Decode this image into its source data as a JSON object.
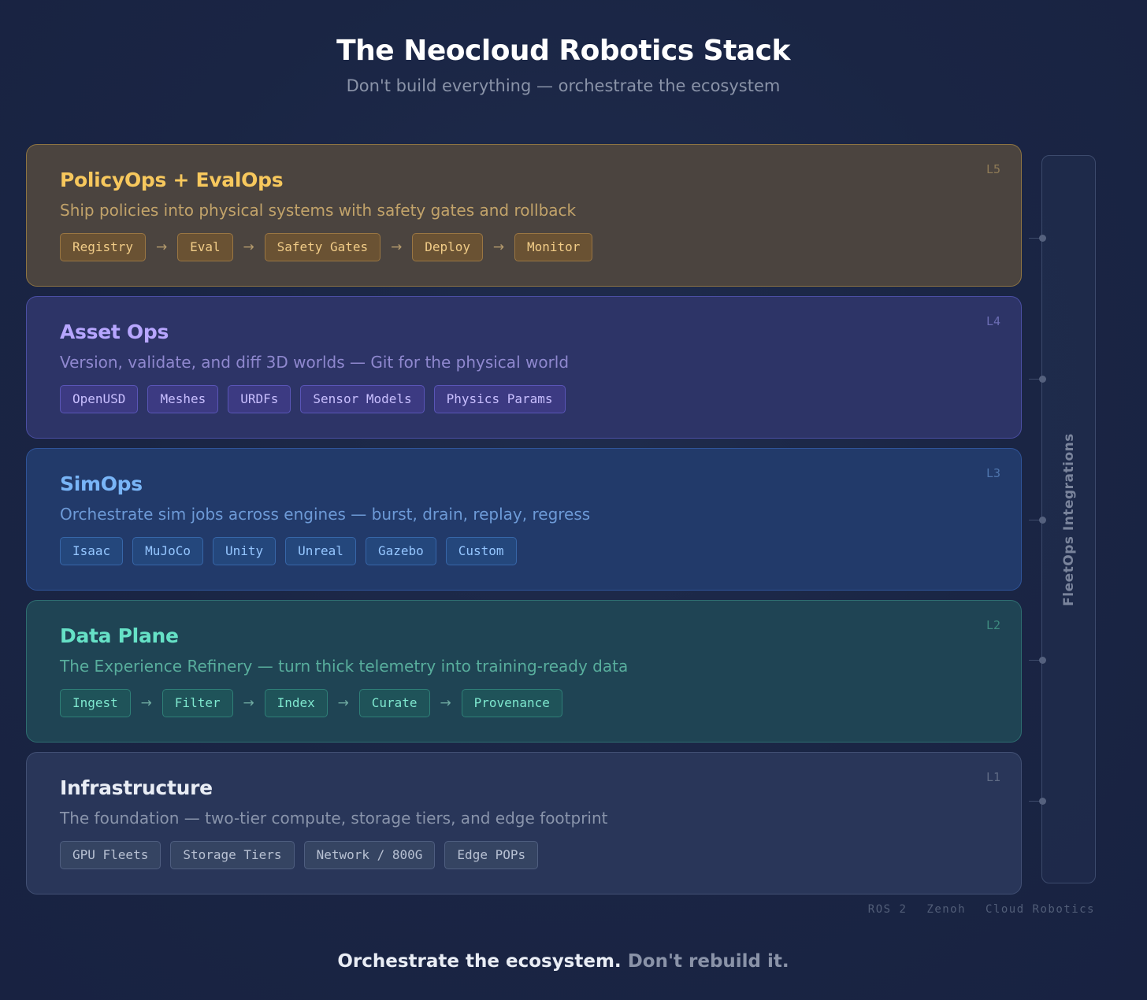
{
  "header": {
    "title": "The Neocloud Robotics Stack",
    "subtitle": "Don't build everything — orchestrate the ecosystem"
  },
  "layers": {
    "l5": {
      "num": "L5",
      "title": "PolicyOps + EvalOps",
      "desc": "Ship policies into physical systems with safety gates and rollback",
      "chips": [
        "Registry",
        "Eval",
        "Safety Gates",
        "Deploy",
        "Monitor"
      ],
      "arrow": "→"
    },
    "l4": {
      "num": "L4",
      "title": "Asset Ops",
      "desc": "Version, validate, and diff 3D worlds — Git for the physical world",
      "chips": [
        "OpenUSD",
        "Meshes",
        "URDFs",
        "Sensor Models",
        "Physics Params"
      ]
    },
    "l3": {
      "num": "L3",
      "title": "SimOps",
      "desc": "Orchestrate sim jobs across engines — burst, drain, replay, regress",
      "chips": [
        "Isaac",
        "MuJoCo",
        "Unity",
        "Unreal",
        "Gazebo",
        "Custom"
      ]
    },
    "l2": {
      "num": "L2",
      "title": "Data Plane",
      "desc": "The Experience Refinery — turn thick telemetry into training-ready data",
      "chips": [
        "Ingest",
        "Filter",
        "Index",
        "Curate",
        "Provenance"
      ],
      "arrow": "→"
    },
    "l1": {
      "num": "L1",
      "title": "Infrastructure",
      "desc": "The foundation — two-tier compute, storage tiers, and edge footprint",
      "chips": [
        "GPU Fleets",
        "Storage Tiers",
        "Network / 800G",
        "Edge POPs"
      ]
    }
  },
  "fleetops": {
    "label": "FleetOps Integrations",
    "tags": [
      "ROS 2",
      "Zenoh",
      "Cloud Robotics"
    ]
  },
  "footer": {
    "strong": "Orchestrate the ecosystem.",
    "muted": "Don't rebuild it."
  }
}
